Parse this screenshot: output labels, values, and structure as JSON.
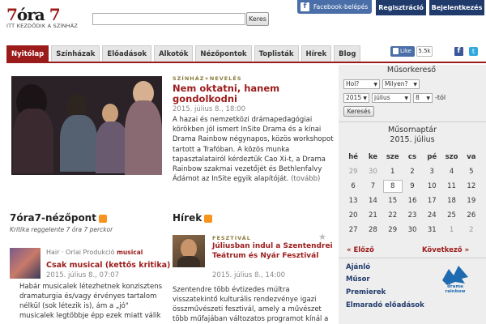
{
  "logo": {
    "part1": "7",
    "part2": "óra",
    "part3": "7",
    "tagline": "ITT KEZDŐDIK A SZÍNHÁZ"
  },
  "search": {
    "placeholder": "",
    "button": "Keres"
  },
  "header": {
    "facebook_login": "Facebook-belépés",
    "register": "Regisztráció",
    "login": "Bejelentkezés"
  },
  "nav": {
    "items": [
      "Nyitólap",
      "Színházak",
      "Előadások",
      "Alkotók",
      "Nézőpontok",
      "Toplisták",
      "Hírek",
      "Blog"
    ]
  },
  "social": {
    "like": "Like",
    "like_count": "5.5k"
  },
  "featured": {
    "kicker": "SZÍNHÁZ+NEVELÉS",
    "title": "Nem oktatni, hanem gondolkodni",
    "meta": "2015. július 8., 18:00",
    "body": "A hazai és nemzetközi drámapedagógiai körökben jól ismert InSite Drama és a kínai Drama Rainbow négynapos, közös workshopot tartott a Trafóban. A közös munka tapasztalatairól kérdeztük Cao Xi-t, a Drama Rainbow szakmai vezetőjét és Bethlenfalvy Ádámot az InSite egyik alapítóját.",
    "more": "(tovább)"
  },
  "nezopont": {
    "title": "7óra7-nézőpont",
    "subtitle": "Kritika reggelente 7 óra 7 perckor",
    "category": "Hair · Orlai Produkció",
    "tag": "musical",
    "item_title": "Csak musical (kettős kritika)",
    "meta": "2015. július 8., 07:07",
    "body": "Habár musicalek létezhetnek konzisztens dramaturgia és/vagy érvényes tartalom nélkül (sok létezik is), ám a „jó\" musicalek legtöbbje épp ezek miatt válik"
  },
  "hirek": {
    "title": "Hírek",
    "kicker": "FESZTIVÁL",
    "item_title": "Júliusban indul a Szentendrei Teátrum és Nyár Fesztivál",
    "meta": "2015. július 8., 14:00",
    "body": "Szentendre több évtizedes múltra visszatekintő kulturális rendezvénye igazi összművészeti fesztivál, amely a művészet több műfajában változatos programot kínál a"
  },
  "musorkereso": {
    "title": "Műsorkereső",
    "select1": "Hol?",
    "select2": "Milyen?",
    "year": "2015",
    "month": "július",
    "day": "8",
    "from_label": "-tól",
    "button": "Keresés"
  },
  "calendar": {
    "title": "Műsornaptár",
    "month_label": "2015. július",
    "headers": [
      "hé",
      "ke",
      "sze",
      "cs",
      "pé",
      "szo",
      "va"
    ],
    "weeks": [
      [
        "29",
        "30",
        "1",
        "2",
        "3",
        "4",
        "5"
      ],
      [
        "6",
        "7",
        "8",
        "9",
        "10",
        "11",
        "12"
      ],
      [
        "13",
        "14",
        "15",
        "16",
        "17",
        "18",
        "19"
      ],
      [
        "20",
        "21",
        "22",
        "23",
        "24",
        "25",
        "26"
      ],
      [
        "27",
        "28",
        "29",
        "30",
        "31",
        "1",
        "2"
      ]
    ],
    "prev": "« Előző",
    "next": "Következő »"
  },
  "sidebar_links": [
    "Ajánló",
    "Műsor",
    "Premierek",
    "Elmaradó előadások"
  ],
  "drama_logo_text": "drama rainbow"
}
